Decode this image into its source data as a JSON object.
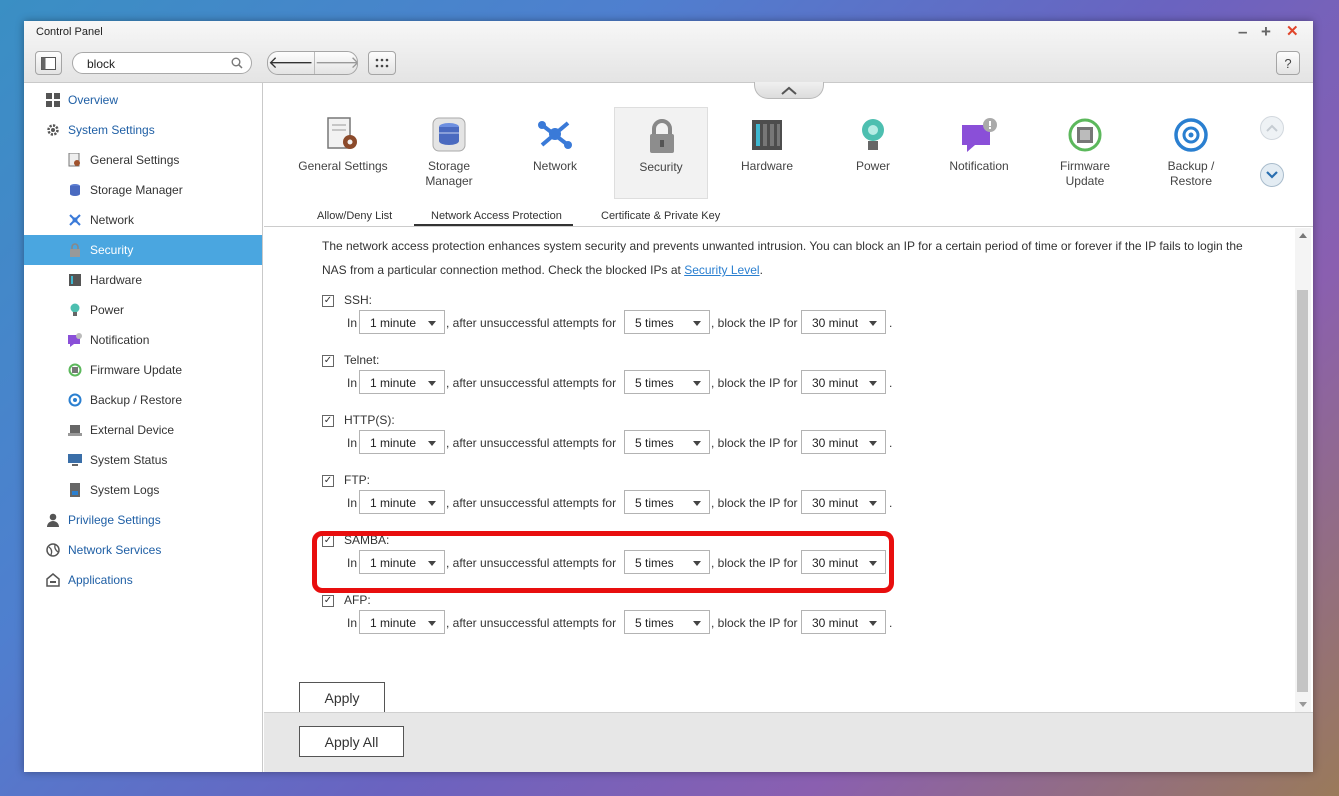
{
  "window": {
    "title": "Control Panel",
    "minimize": "–",
    "maximize": "+",
    "close": "✕",
    "help": "?"
  },
  "search": {
    "value": "block",
    "placeholder": ""
  },
  "nav": {
    "back": "🡐",
    "forward": "🡒"
  },
  "sidebar": {
    "overview": "Overview",
    "system_settings": "System Settings",
    "items": [
      "General Settings",
      "Storage Manager",
      "Network",
      "Security",
      "Hardware",
      "Power",
      "Notification",
      "Firmware Update",
      "Backup / Restore",
      "External Device",
      "System Status",
      "System Logs"
    ],
    "privilege_settings": "Privilege Settings",
    "network_services": "Network Services",
    "applications": "Applications"
  },
  "categories": [
    {
      "label": "General Settings"
    },
    {
      "label": "Storage Manager"
    },
    {
      "label": "Network"
    },
    {
      "label": "Security"
    },
    {
      "label": "Hardware"
    },
    {
      "label": "Power"
    },
    {
      "label": "Notification"
    },
    {
      "label": "Firmware Update"
    },
    {
      "label": "Backup / Restore"
    }
  ],
  "subtabs": [
    "Allow/Deny List",
    "Network Access Protection",
    "Certificate & Private Key"
  ],
  "description": {
    "text": "The network access protection enhances system security and prevents unwanted intrusion. You can block an IP for a certain period of time or forever if the IP fails to login the NAS from a particular connection method. Check the blocked IPs at ",
    "link": "Security Level",
    "end": "."
  },
  "row_text": {
    "in": "In",
    "after": ", after unsuccessful attempts for",
    "block": ", block the IP for",
    "period": "."
  },
  "services": [
    {
      "name": "SSH:",
      "checked": true,
      "within": "1 minute",
      "attempts": "5 times",
      "block_for": "30 minut"
    },
    {
      "name": "Telnet:",
      "checked": true,
      "within": "1 minute",
      "attempts": "5 times",
      "block_for": "30 minut"
    },
    {
      "name": "HTTP(S):",
      "checked": true,
      "within": "1 minute",
      "attempts": "5 times",
      "block_for": "30 minut"
    },
    {
      "name": "FTP:",
      "checked": true,
      "within": "1 minute",
      "attempts": "5 times",
      "block_for": "30 minut"
    },
    {
      "name": "SAMBA:",
      "checked": true,
      "within": "1 minute",
      "attempts": "5 times",
      "block_for": "30 minut"
    },
    {
      "name": "AFP:",
      "checked": true,
      "within": "1 minute",
      "attempts": "5 times",
      "block_for": "30 minut"
    }
  ],
  "buttons": {
    "apply": "Apply",
    "apply_all": "Apply All"
  },
  "colors": {
    "accent": "#4aa6e0",
    "highlight": "#e80e0e",
    "link": "#2a7fd0"
  }
}
